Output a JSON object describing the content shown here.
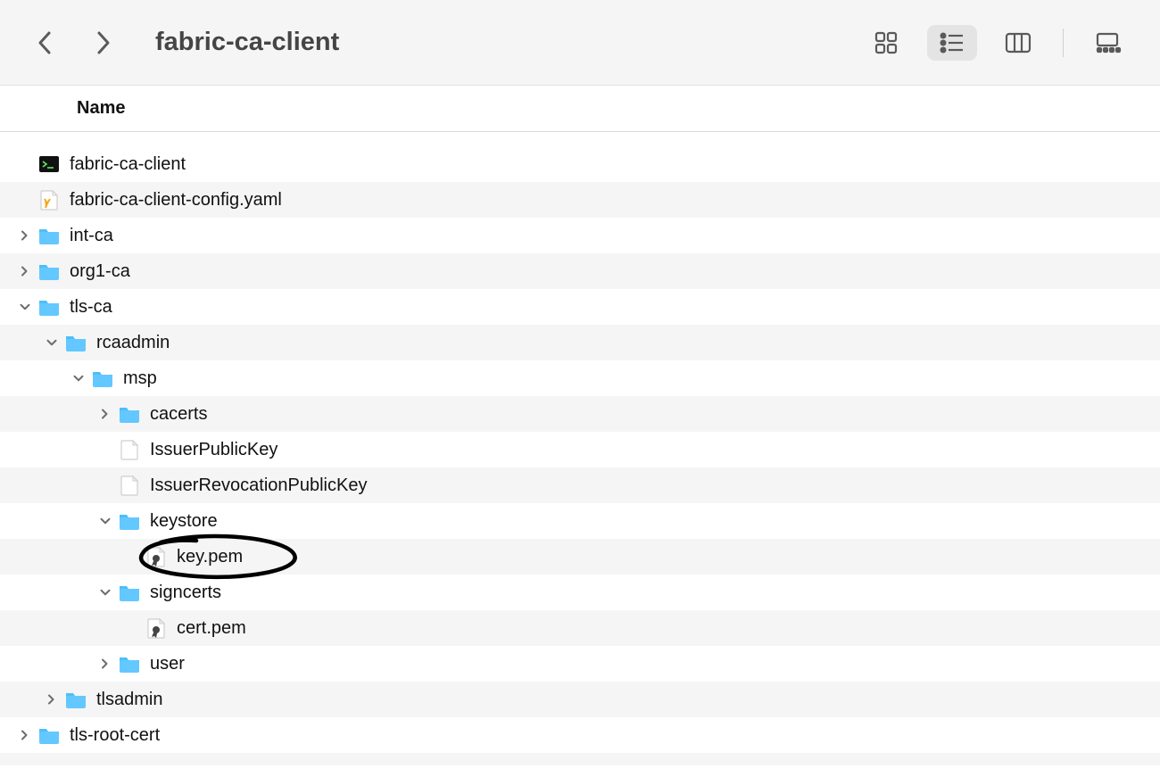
{
  "toolbar": {
    "title": "fabric-ca-client"
  },
  "columns": {
    "name": "Name"
  },
  "tree": {
    "fabric_ca_client_bin": "fabric-ca-client",
    "config_yaml": "fabric-ca-client-config.yaml",
    "int_ca": "int-ca",
    "org1_ca": "org1-ca",
    "tls_ca": "tls-ca",
    "rcaadmin": "rcaadmin",
    "msp": "msp",
    "cacerts": "cacerts",
    "issuer_public_key": "IssuerPublicKey",
    "issuer_revocation_public_key": "IssuerRevocationPublicKey",
    "keystore": "keystore",
    "key_pem": "key.pem",
    "signcerts": "signcerts",
    "cert_pem": "cert.pem",
    "user": "user",
    "tlsadmin": "tlsadmin",
    "tls_root_cert": "tls-root-cert"
  }
}
